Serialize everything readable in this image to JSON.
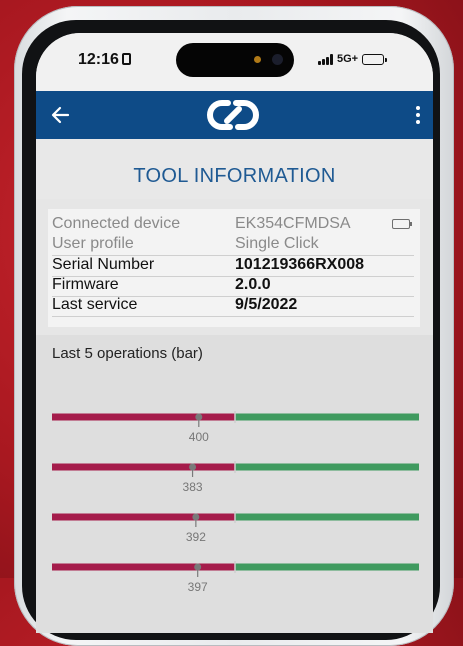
{
  "status_bar": {
    "time": "12:16",
    "network": "5G+",
    "battery_level": 0.7
  },
  "app_bar": {
    "logo": "link-logo-icon",
    "back": "back-arrow-icon",
    "menu": "kebab-menu-icon"
  },
  "page": {
    "title": "TOOL INFORMATION"
  },
  "tool_info": {
    "rows": [
      {
        "label": "Connected device",
        "value": "EK354CFMDSA",
        "muted": true
      },
      {
        "label": "User profile",
        "value": "Single Click",
        "muted": true
      },
      {
        "label": "Serial Number",
        "value": "101219366RX008",
        "muted": false
      },
      {
        "label": "Firmware",
        "value": "2.0.0",
        "muted": false
      },
      {
        "label": "Last service",
        "value": "9/5/2022",
        "muted": false
      }
    ],
    "device_battery_icon": "device-battery-icon"
  },
  "operations": {
    "title": "Last 5 operations (bar)",
    "unit": "bar",
    "items": [
      {
        "value": 400,
        "value_label": "400"
      },
      {
        "value": 383,
        "value_label": "383"
      },
      {
        "value": 392,
        "value_label": "392"
      },
      {
        "value": 397,
        "value_label": "397"
      }
    ]
  },
  "colors": {
    "app_bar": "#0e4b87",
    "title_text": "#1f5a93",
    "bar_low": "#a51c4b",
    "bar_high": "#3f9a5f",
    "threshold_marker": "#cfcfcf",
    "value_marker": "#7a7a7a"
  }
}
